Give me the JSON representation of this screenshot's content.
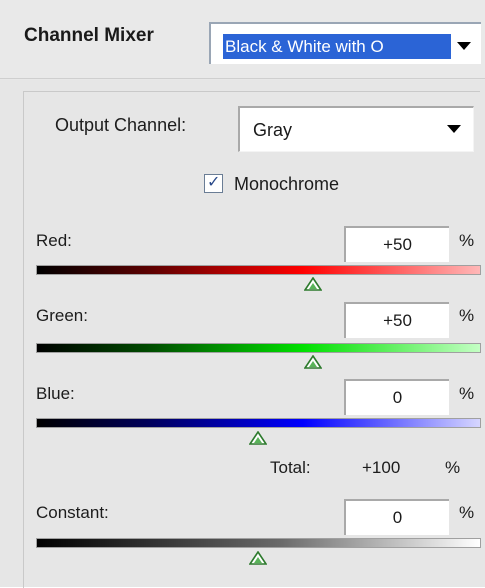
{
  "panel": {
    "title": "Channel Mixer",
    "preset": {
      "value": "Black & White with O"
    }
  },
  "output": {
    "label": "Output Channel:",
    "value": "Gray"
  },
  "monochrome": {
    "label": "Monochrome",
    "checked": true
  },
  "sliders": [
    {
      "label": "Red:",
      "value": "+50",
      "unit": "%",
      "percent": 50
    },
    {
      "label": "Green:",
      "value": "+50",
      "unit": "%",
      "percent": 50
    },
    {
      "label": "Blue:",
      "value": "0",
      "unit": "%",
      "percent": 0
    }
  ],
  "total": {
    "label": "Total:",
    "value": "+100",
    "unit": "%"
  },
  "constant": {
    "label": "Constant:",
    "value": "0",
    "unit": "%",
    "percent": 0
  }
}
